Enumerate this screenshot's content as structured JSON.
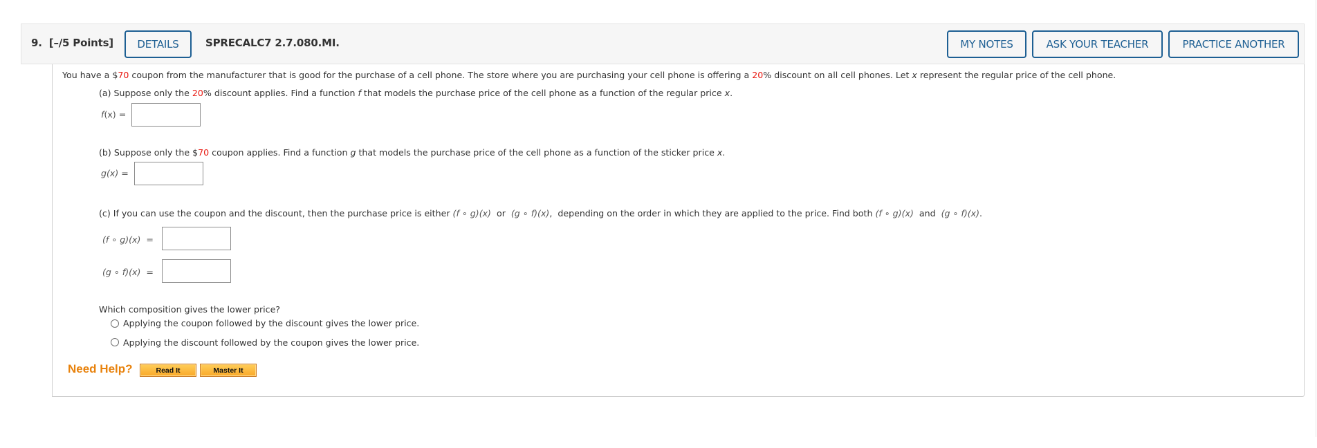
{
  "header": {
    "question_number": "9.",
    "points": "[–/5 Points]",
    "details_label": "DETAILS",
    "problem_code": "SPRECALC7 2.7.080.MI.",
    "my_notes_label": "MY NOTES",
    "ask_teacher_label": "ASK YOUR TEACHER",
    "practice_another_label": "PRACTICE ANOTHER"
  },
  "intro": {
    "p1": "You have a $",
    "coupon": "70",
    "p2": " coupon from the manufacturer that is good for the purchase of a cell phone. The store where you are purchasing your cell phone is offering a ",
    "discount": "20",
    "p3": "% discount on all cell phones. Let ",
    "var": "x",
    "p4": " represent the regular price of the cell phone."
  },
  "part_a": {
    "p1": "(a) Suppose only the ",
    "discount": "20",
    "p2": "% discount applies. Find a function ",
    "fn": "f",
    "p3": " that models the purchase price of the cell phone as a function of the regular price ",
    "var": "x",
    "p4": ".",
    "label_fn": "f",
    "label_rest": "(x) =",
    "value": ""
  },
  "part_b": {
    "p1": "(b) Suppose only the $",
    "coupon": "70",
    "p2": " coupon applies. Find a function ",
    "fn": "g",
    "p3": " that models the purchase price of the cell phone as a function of the sticker price ",
    "var": "x",
    "p4": ".",
    "label": "g(x) =",
    "value": ""
  },
  "part_c": {
    "p1": "(c) If you can use the coupon and the discount, then the purchase price is either ",
    "fog": "(f ∘ g)(x)",
    "p2": "  or  ",
    "gof": "(g ∘ f)(x)",
    "p3": ",  depending on the order in which they are applied to the price. Find both ",
    "fog2": "(f ∘ g)(x)",
    "p4": "  and  ",
    "gof2": "(g ∘ f)(x)",
    "p5": ".",
    "fog_label": "(f ∘ g)(x)  =",
    "gof_label": "(g ∘ f)(x)  =",
    "fog_value": "",
    "gof_value": ""
  },
  "question": {
    "prompt": "Which composition gives the lower price?",
    "options": [
      "Applying the coupon followed by the discount gives the lower price.",
      "Applying the discount followed by the coupon gives the lower price."
    ]
  },
  "help": {
    "label": "Need Help?",
    "read_it": "Read It",
    "master_it": "Master It"
  }
}
